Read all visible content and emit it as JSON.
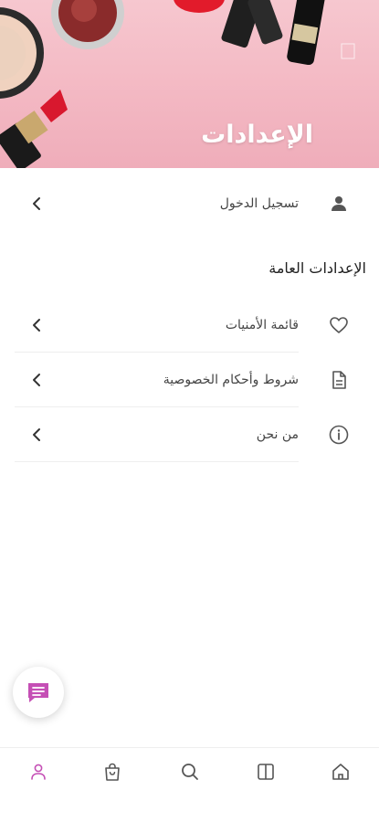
{
  "header": {
    "title": "الإعدادات"
  },
  "account": {
    "login_label": "تسجيل الدخول",
    "icon": "person-icon"
  },
  "general_settings": {
    "title": "الإعدادات العامة",
    "items": [
      {
        "label": "قائمة الأمنيات",
        "icon": "heart-icon"
      },
      {
        "label": "شروط وأحكام الخصوصية",
        "icon": "document-icon"
      },
      {
        "label": "من نحن",
        "icon": "info-icon"
      }
    ]
  },
  "chat_button": {
    "icon": "chat-icon"
  },
  "bottom_nav": {
    "items": [
      {
        "icon": "profile-icon",
        "active": true
      },
      {
        "icon": "shopping-bag-icon"
      },
      {
        "icon": "search-icon"
      },
      {
        "icon": "columns-icon"
      },
      {
        "icon": "home-icon"
      }
    ]
  },
  "colors": {
    "accent": "#c54fb5",
    "icon": "#555555",
    "chevron": "#333333",
    "header_bg": "#f5c1ca"
  }
}
